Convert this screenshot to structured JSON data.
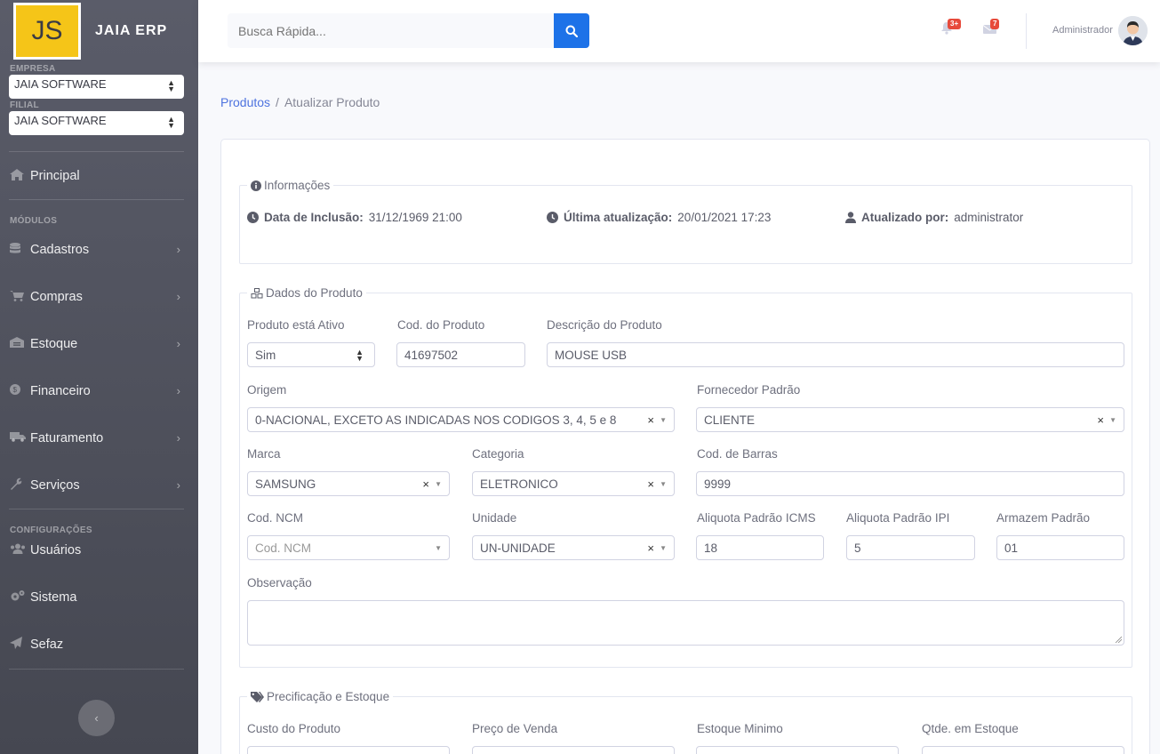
{
  "brand": {
    "logo_text": "JS",
    "name": "JAIA ERP"
  },
  "sidebar": {
    "empresa_label": "EMPRESA",
    "empresa_value": "JAIA SOFTWARE",
    "filial_label": "FILIAL",
    "filial_value": "JAIA SOFTWARE",
    "principal": "Principal",
    "modulos_heading": "MÓDULOS",
    "modules": [
      {
        "label": "Cadastros",
        "icon": "database-icon"
      },
      {
        "label": "Compras",
        "icon": "cart-icon"
      },
      {
        "label": "Estoque",
        "icon": "warehouse-icon"
      },
      {
        "label": "Financeiro",
        "icon": "money-icon"
      },
      {
        "label": "Faturamento",
        "icon": "truck-icon"
      },
      {
        "label": "Serviços",
        "icon": "wrench-icon"
      }
    ],
    "config_heading": "CONFIGURAÇÕES",
    "config_items": [
      {
        "label": "Usuários",
        "icon": "users-icon"
      },
      {
        "label": "Sistema",
        "icon": "cogs-icon"
      },
      {
        "label": "Sefaz",
        "icon": "paper-plane-icon"
      }
    ]
  },
  "topbar": {
    "search_placeholder": "Busca Rápida...",
    "alerts_badge": "3+",
    "messages_badge": "7",
    "user_name": "Administrador"
  },
  "breadcrumb": {
    "parent": "Produtos",
    "separator": "/",
    "current": "Atualizar Produto"
  },
  "info": {
    "legend": "Informações",
    "inclusao_label": "Data de Inclusão:",
    "inclusao_value": "31/12/1969 21:00",
    "atualizacao_label": "Última atualização:",
    "atualizacao_value": "20/01/2021 17:23",
    "atualizado_por_label": "Atualizado por:",
    "atualizado_por_value": "administrator"
  },
  "produto": {
    "legend": "Dados do Produto",
    "ativo_label": "Produto está Ativo",
    "ativo_value": "Sim",
    "cod_label": "Cod. do Produto",
    "cod_value": "41697502",
    "descricao_label": "Descrição do Produto",
    "descricao_value": "MOUSE USB",
    "origem_label": "Origem",
    "origem_value": "0-NACIONAL, EXCETO AS INDICADAS NOS CODIGOS 3, 4, 5 e 8",
    "fornecedor_label": "Fornecedor Padrão",
    "fornecedor_value": "CLIENTE",
    "marca_label": "Marca",
    "marca_value": "SAMSUNG",
    "categoria_label": "Categoria",
    "categoria_value": "ELETRONICO",
    "barras_label": "Cod. de Barras",
    "barras_value": "9999",
    "ncm_label": "Cod. NCM",
    "ncm_placeholder": "Cod. NCM",
    "unidade_label": "Unidade",
    "unidade_value": "UN-UNIDADE",
    "icms_label": "Aliquota Padrão ICMS",
    "icms_value": "18",
    "ipi_label": "Aliquota Padrão IPI",
    "ipi_value": "5",
    "armazem_label": "Armazem Padrão",
    "armazem_value": "01",
    "obs_label": "Observação",
    "obs_value": ""
  },
  "preco": {
    "legend": "Precificação e Estoque",
    "custo_label": "Custo do Produto",
    "venda_label": "Preço de Venda",
    "estoque_min_label": "Estoque Minimo",
    "qtde_label": "Qtde. em Estoque"
  },
  "colors": {
    "primary": "#1d72e8",
    "sidebar": "#5a5c69",
    "logo": "#f5c518",
    "badge": "#e74a3b"
  }
}
